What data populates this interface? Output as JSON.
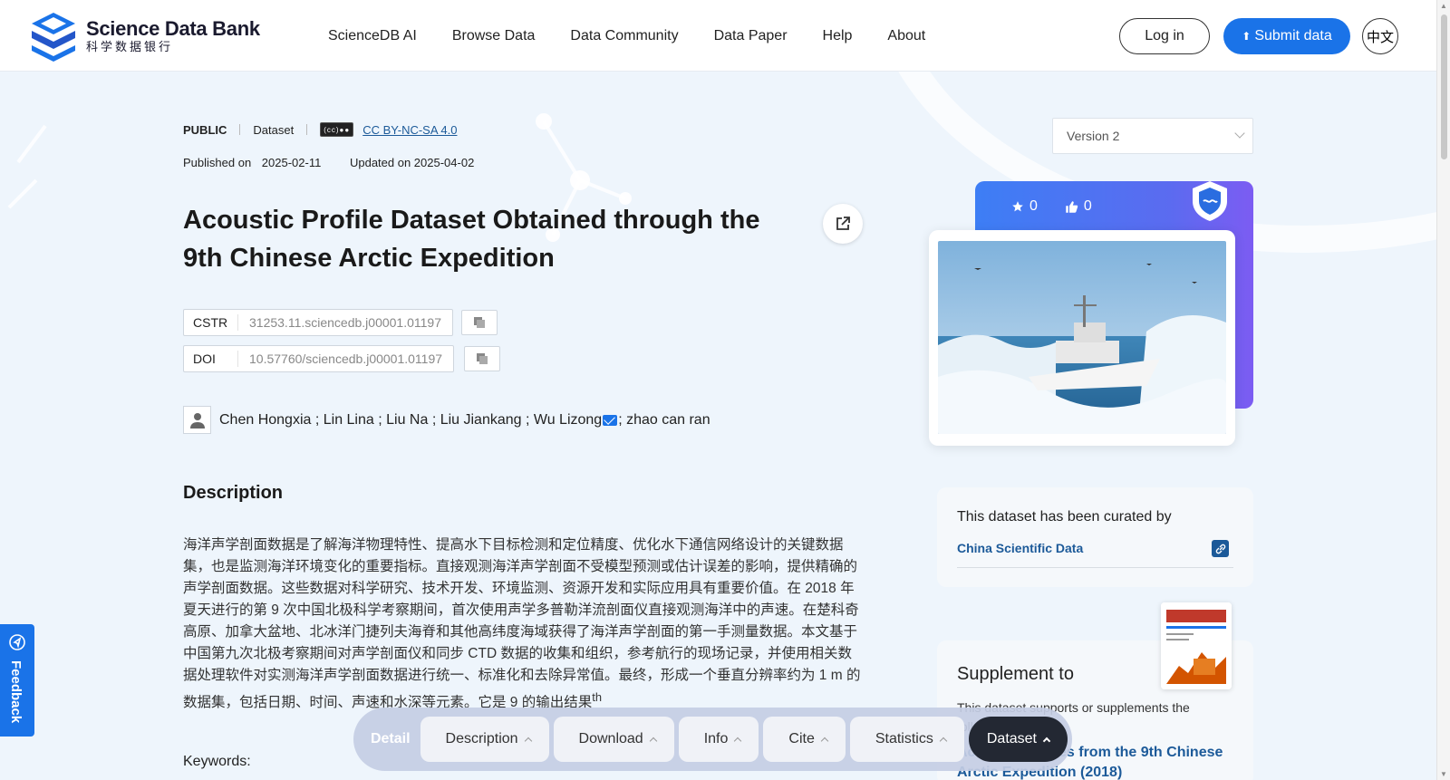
{
  "header": {
    "logo_en": "Science Data Bank",
    "logo_zh": "科学数据银行",
    "nav": [
      "ScienceDB AI",
      "Browse Data",
      "Data Community",
      "Data Paper",
      "Help",
      "About"
    ],
    "login": "Log in",
    "submit": "Submit data",
    "lang": "中文"
  },
  "meta": {
    "visibility": "PUBLIC",
    "type": "Dataset",
    "license": "CC BY-NC-SA 4.0",
    "published_label": "Published on",
    "published": "2025-02-11",
    "updated": "Updated on 2025-04-02"
  },
  "title": "Acoustic Profile Dataset Obtained through the 9th Chinese Arctic Expedition",
  "ids": {
    "cstr_label": "CSTR",
    "cstr": "31253.11.sciencedb.j00001.01197",
    "doi_label": "DOI",
    "doi": "10.57760/sciencedb.j00001.01197"
  },
  "authors": {
    "main": "Chen Hongxia ; Lin Lina ; Liu Na ; Liu Jiankang ; Wu Lizong",
    "rest": "; zhao can ran"
  },
  "description": {
    "heading": "Description",
    "text": "海洋声学剖面数据是了解海洋物理特性、提高水下目标检测和定位精度、优化水下通信网络设计的关键数据集，也是监测海洋环境变化的重要指标。直接观测海洋声学剖面不受模型预测或估计误差的影响，提供精确的声学剖面数据。这些数据对科学研究、技术开发、环境监测、资源开发和实际应用具有重要价值。在 2018 年夏天进行的第 9 次中国北极科学考察期间，首次使用声学多普勒洋流剖面仪直接观测海洋中的声速。在楚科奇高原、加拿大盆地、北冰洋门捷列夫海脊和其他高纬度海域获得了海洋声学剖面的第一手测量数据。本文基于中国第九次北极考察期间对声学剖面仪和同步 CTD 数据的收集和组织，参考航行的现场记录，并使用相关数据处理软件对实测海洋声学剖面数据进行统一、标准化和去除异常值。最终，形成一个垂直分辨率约为 1 m 的数据集，包括日期、时间、声速和水深等元素。它是 9 的输出结果",
    "sup": "th"
  },
  "keywords_label": "Keywords:",
  "sidebar": {
    "version": "Version 2",
    "stars": "0",
    "likes": "0",
    "curated_title": "This dataset has been curated by",
    "curated_org": "China Scientific Data",
    "supplement_heading": "Supplement to",
    "supplement_text": "This dataset supports or supplements the following papers",
    "supplement_paper": "Acoustic profiles from the 9th Chinese Arctic Expedition (2018)"
  },
  "feedback": "Feedback",
  "bottom_nav": {
    "detail": "Detail",
    "tabs": [
      "Description",
      "Download",
      "Info",
      "Cite",
      "Statistics",
      "Dataset"
    ]
  },
  "colors": {
    "primary": "#1a73e8",
    "link": "#1c5a99",
    "dark_tab": "#232833"
  }
}
